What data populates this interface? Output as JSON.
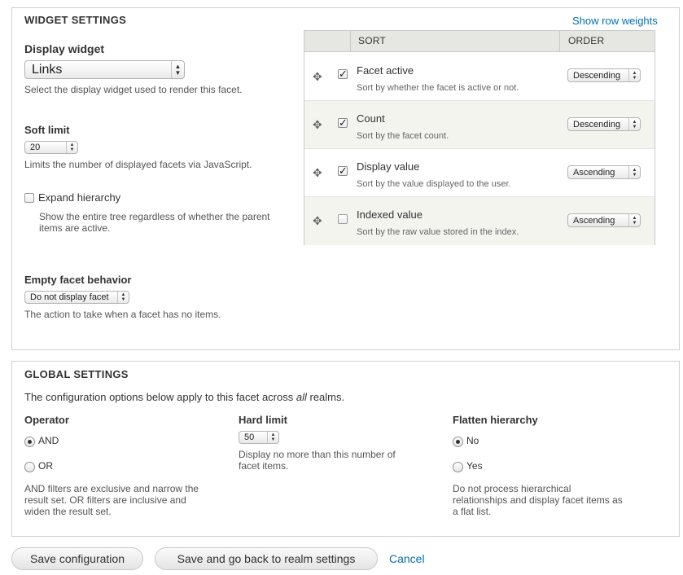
{
  "widget_settings": {
    "legend": "WIDGET SETTINGS",
    "show_row_weights": "Show row weights",
    "display_widget": {
      "label": "Display widget",
      "value": "Links",
      "description": "Select the display widget used to render this facet."
    },
    "soft_limit": {
      "label": "Soft limit",
      "value": "20",
      "description": "Limits the number of displayed facets via JavaScript."
    },
    "expand_hierarchy": {
      "label": "Expand hierarchy",
      "checked": false,
      "description_line1": "Show the entire tree regardless of whether the parent",
      "description_line2": "items are active."
    },
    "empty_facet": {
      "label": "Empty facet behavior",
      "value": "Do not display facet",
      "description": "The action to take when a facet has no items."
    },
    "sort_table": {
      "headers": {
        "sort": "SORT",
        "order": "ORDER"
      },
      "rows": [
        {
          "title": "Facet active",
          "description": "Sort by whether the facet is active or not.",
          "checked": true,
          "order": "Descending"
        },
        {
          "title": "Count",
          "description": "Sort by the facet count.",
          "checked": true,
          "order": "Descending"
        },
        {
          "title": "Display value",
          "description": "Sort by the value displayed to the user.",
          "checked": true,
          "order": "Ascending"
        },
        {
          "title": "Indexed value",
          "description": "Sort by the raw value stored in the index.",
          "checked": false,
          "order": "Ascending"
        }
      ]
    }
  },
  "global_settings": {
    "legend": "GLOBAL SETTINGS",
    "intro_before": "The configuration options below apply to this facet across ",
    "intro_emphasis": "all",
    "intro_after": " realms.",
    "operator": {
      "label": "Operator",
      "options": [
        "AND",
        "OR"
      ],
      "selected": "AND",
      "description_line1": "AND filters are exclusive and narrow the",
      "description_line2": "result set. OR filters are inclusive and",
      "description_line3": "widen the result set."
    },
    "hard_limit": {
      "label": "Hard limit",
      "value": "50",
      "description_line1": "Display no more than this number of",
      "description_line2": "facet items."
    },
    "flatten_hierarchy": {
      "label": "Flatten hierarchy",
      "options": [
        "No",
        "Yes"
      ],
      "selected": "No",
      "description_line1": "Do not process hierarchical",
      "description_line2": "relationships and display facet items as",
      "description_line3": "a flat list."
    }
  },
  "actions": {
    "save": "Save configuration",
    "save_back": "Save and go back to realm settings",
    "cancel": "Cancel"
  },
  "icons": {
    "drag": "drag-handle-icon",
    "select_arrows": "select-arrows-icon",
    "check": "checkmark-icon"
  },
  "colors": {
    "link": "#0071b3",
    "table_header": "#e6e6e2",
    "row_stripe": "#f3f4ee"
  }
}
